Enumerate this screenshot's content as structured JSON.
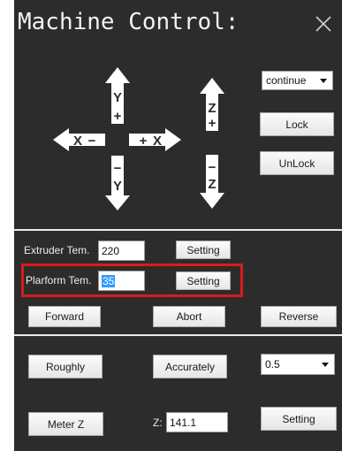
{
  "window": {
    "title": "Machine Control:"
  },
  "jog": {
    "y_plus": "Y",
    "y_plus_sign": "+",
    "y_minus": "Y",
    "y_minus_sign": "−",
    "x_minus": "X",
    "x_minus_sign": "−",
    "x_plus": "X",
    "x_plus_sign": "+",
    "z_plus": "Z",
    "z_plus_sign": "+",
    "z_minus": "Z",
    "z_minus_sign": "−"
  },
  "mode": {
    "selected": "continue"
  },
  "buttons": {
    "lock": "Lock",
    "unlock": "UnLock",
    "extruder_setting": "Setting",
    "platform_setting": "Setting",
    "forward": "Forward",
    "abort": "Abort",
    "reverse": "Reverse",
    "roughly": "Roughly",
    "accurately": "Accurately",
    "meter_z": "Meter Z",
    "z_setting": "Setting"
  },
  "extruder": {
    "label": "Extruder Tem.",
    "value": "220"
  },
  "platform": {
    "label": "Plarform Tem.",
    "value": "35"
  },
  "step": {
    "selected": "0.5"
  },
  "z": {
    "label": "Z:",
    "value": "141.1"
  },
  "colors": {
    "background": "#2c2c2c",
    "highlight": "#d81c1c",
    "selection": "#3399ff"
  }
}
